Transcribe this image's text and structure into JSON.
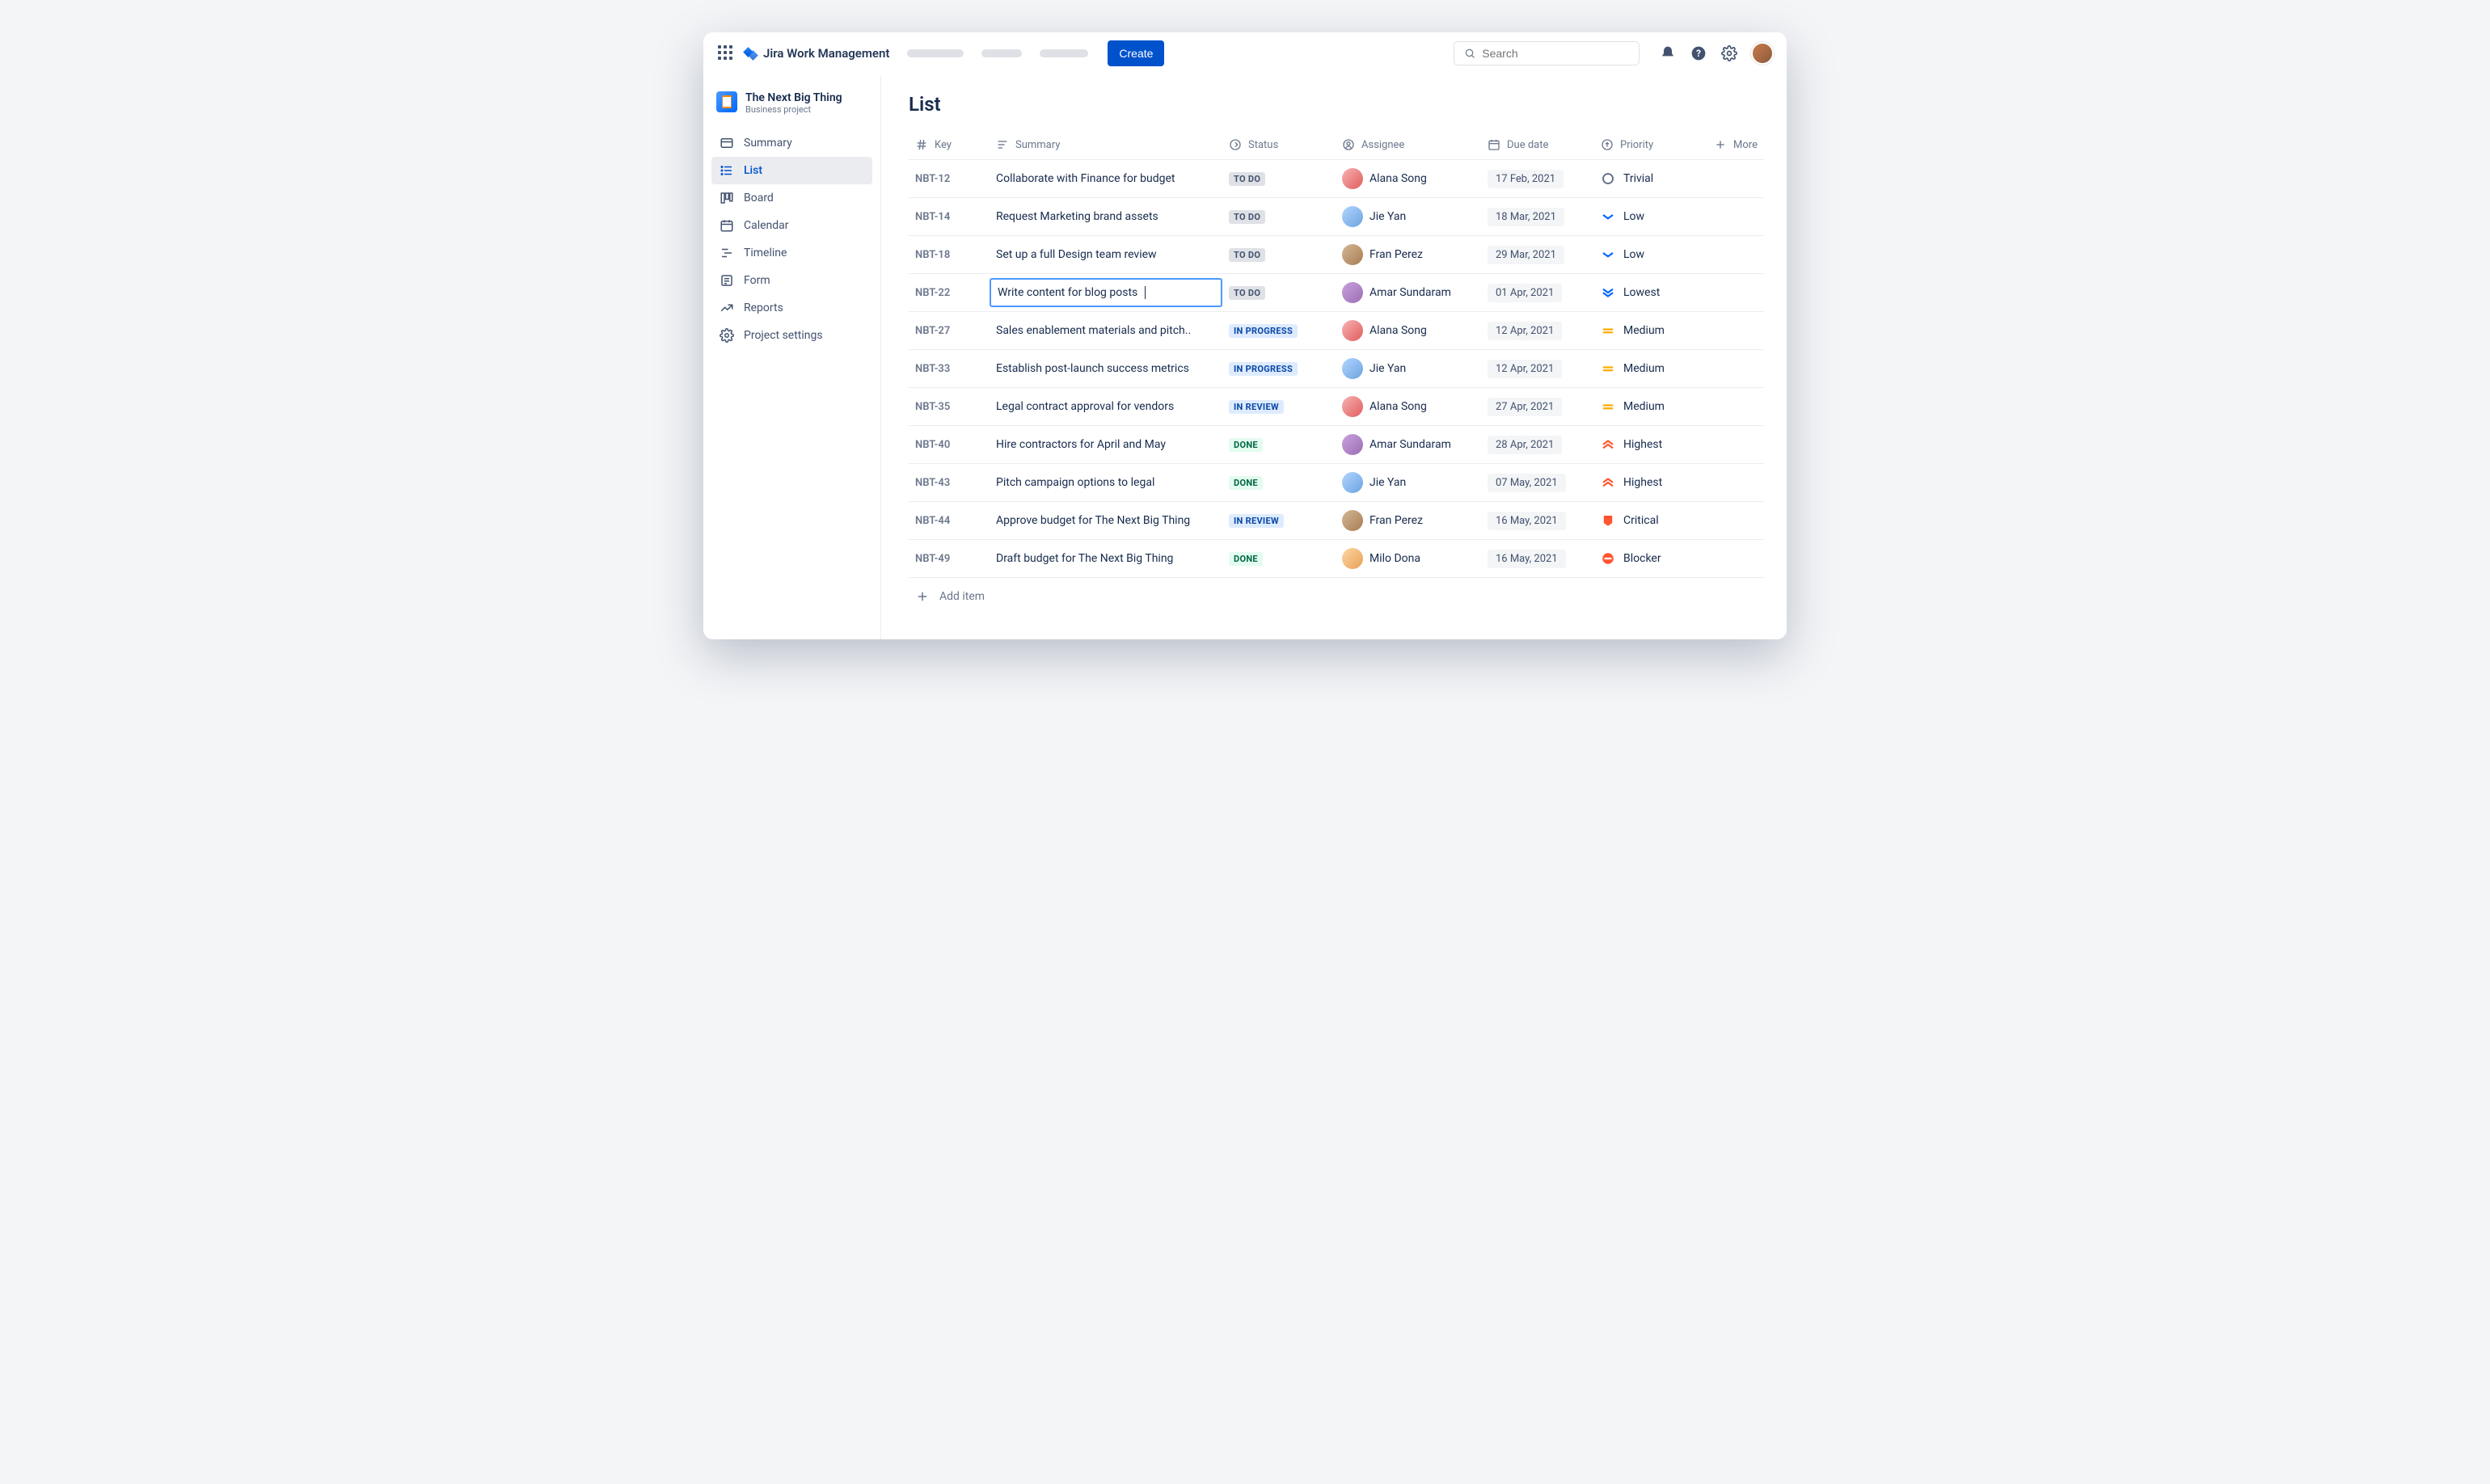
{
  "header": {
    "product_name": "Jira Work Management",
    "create_label": "Create",
    "search_placeholder": "Search"
  },
  "project": {
    "name": "The Next Big Thing",
    "type": "Business project"
  },
  "sidebar": {
    "items": [
      {
        "label": "Summary",
        "icon": "summary"
      },
      {
        "label": "List",
        "icon": "list",
        "active": true
      },
      {
        "label": "Board",
        "icon": "board"
      },
      {
        "label": "Calendar",
        "icon": "calendar"
      },
      {
        "label": "Timeline",
        "icon": "timeline"
      },
      {
        "label": "Form",
        "icon": "form"
      },
      {
        "label": "Reports",
        "icon": "reports"
      },
      {
        "label": "Project settings",
        "icon": "settings"
      }
    ]
  },
  "page": {
    "title": "List",
    "add_item_label": "Add item"
  },
  "columns": {
    "key": "Key",
    "summary": "Summary",
    "status": "Status",
    "assignee": "Assignee",
    "due_date": "Due date",
    "priority": "Priority",
    "more": "More"
  },
  "status_labels": {
    "todo": "TO DO",
    "inprogress": "IN PROGRESS",
    "inreview": "IN REVIEW",
    "done": "DONE"
  },
  "priority_labels": {
    "trivial": "Trivial",
    "low": "Low",
    "lowest": "Lowest",
    "medium": "Medium",
    "highest": "Highest",
    "critical": "Critical",
    "blocker": "Blocker"
  },
  "rows": [
    {
      "key": "NBT-12",
      "summary": "Collaborate with Finance for budget",
      "status": "todo",
      "assignee": "Alana Song",
      "avatar": 0,
      "due": "17 Feb, 2021",
      "priority": "trivial"
    },
    {
      "key": "NBT-14",
      "summary": "Request Marketing brand assets",
      "status": "todo",
      "assignee": "Jie Yan",
      "avatar": 1,
      "due": "18 Mar, 2021",
      "priority": "low"
    },
    {
      "key": "NBT-18",
      "summary": "Set up a full Design team review",
      "status": "todo",
      "assignee": "Fran Perez",
      "avatar": 2,
      "due": "29 Mar, 2021",
      "priority": "low"
    },
    {
      "key": "NBT-22",
      "summary": "Write content for blog posts",
      "status": "todo",
      "assignee": "Amar Sundaram",
      "avatar": 3,
      "due": "01 Apr, 2021",
      "priority": "lowest",
      "editing": true
    },
    {
      "key": "NBT-27",
      "summary": "Sales enablement materials and pitch..",
      "status": "inprogress",
      "assignee": "Alana Song",
      "avatar": 0,
      "due": "12 Apr, 2021",
      "priority": "medium"
    },
    {
      "key": "NBT-33",
      "summary": "Establish post-launch success metrics",
      "status": "inprogress",
      "assignee": "Jie Yan",
      "avatar": 1,
      "due": "12 Apr, 2021",
      "priority": "medium"
    },
    {
      "key": "NBT-35",
      "summary": "Legal contract approval for vendors",
      "status": "inreview",
      "assignee": "Alana Song",
      "avatar": 0,
      "due": "27 Apr, 2021",
      "priority": "medium"
    },
    {
      "key": "NBT-40",
      "summary": "Hire contractors for April and May",
      "status": "done",
      "assignee": "Amar Sundaram",
      "avatar": 3,
      "due": "28 Apr, 2021",
      "priority": "highest"
    },
    {
      "key": "NBT-43",
      "summary": "Pitch campaign options to legal",
      "status": "done",
      "assignee": "Jie Yan",
      "avatar": 1,
      "due": "07 May, 2021",
      "priority": "highest"
    },
    {
      "key": "NBT-44",
      "summary": "Approve budget for The Next Big Thing",
      "status": "inreview",
      "assignee": "Fran Perez",
      "avatar": 2,
      "due": "16 May, 2021",
      "priority": "critical"
    },
    {
      "key": "NBT-49",
      "summary": "Draft budget for The Next Big Thing",
      "status": "done",
      "assignee": "Milo Dona",
      "avatar": 4,
      "due": "16 May, 2021",
      "priority": "blocker"
    }
  ]
}
